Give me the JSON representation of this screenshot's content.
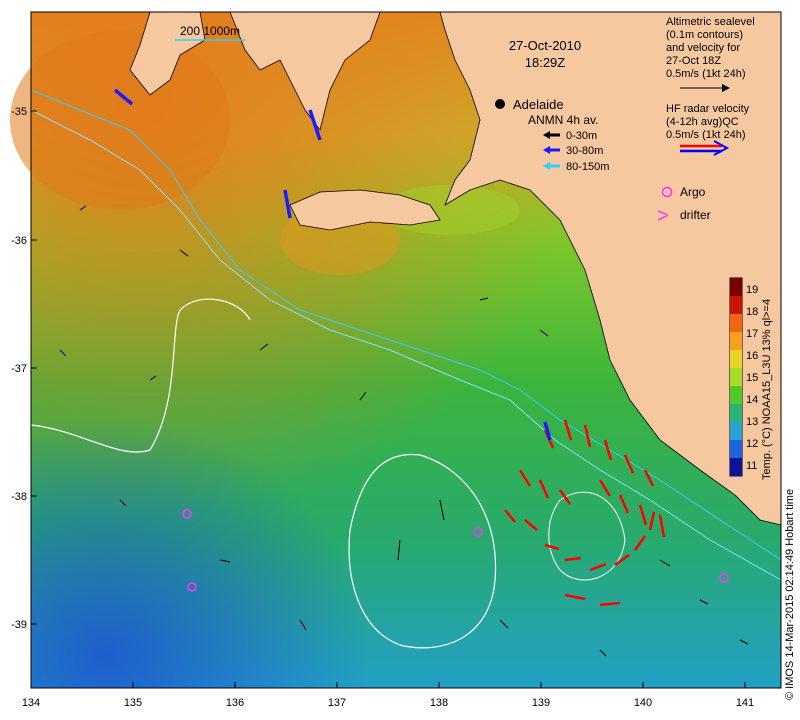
{
  "date": "27-Oct-2010",
  "time": "18:29Z",
  "scale_bar": {
    "label": "200  1000m"
  },
  "city": {
    "name": "Adelaide"
  },
  "anmn": {
    "title": "ANMN 4h av.",
    "items": [
      {
        "label": "0-30m",
        "color": "#000000"
      },
      {
        "label": "30-80m",
        "color": "#1a1aff"
      },
      {
        "label": "80-150m",
        "color": "#33ccff"
      }
    ]
  },
  "altimetry": {
    "lines": [
      "Altimetric sealevel",
      "(0.1m contours)",
      "and velocity for",
      "27-Oct 18Z",
      "0.5m/s (1kt 24h)"
    ]
  },
  "hf_radar": {
    "lines": [
      "HF radar velocity",
      "(4-12h avg)QC",
      "0.5m/s (1kt 24h)"
    ],
    "colors": [
      "#ff0000",
      "#0000ff"
    ]
  },
  "argo": {
    "label": "Argo",
    "color": "#ff33ff"
  },
  "drifter": {
    "label": "drifter",
    "symbol": ">",
    "color": "#ff33ff"
  },
  "colorbar": {
    "title": "Temp. (°C) NOAA15_L3U 13% ql>=4",
    "ticks": [
      "19",
      "18",
      "17",
      "16",
      "15",
      "14",
      "13",
      "12",
      "11"
    ],
    "colors": [
      "#7a0000",
      "#c81400",
      "#f06414",
      "#f5a01e",
      "#e6d228",
      "#a8dc28",
      "#50c828",
      "#28b478",
      "#28a0d2",
      "#1e64dc",
      "#0a1496"
    ]
  },
  "credit": "© IMOS 14-Mar-2015 02:14:49 Hobart time",
  "axes": {
    "x_ticks": [
      "134",
      "135",
      "136",
      "137",
      "138",
      "139",
      "140",
      "141"
    ],
    "y_ticks": [
      "-35",
      "-36",
      "-37",
      "-38",
      "-39"
    ]
  },
  "colors": {
    "land": "#f5c8a0",
    "frame": "#000000"
  }
}
